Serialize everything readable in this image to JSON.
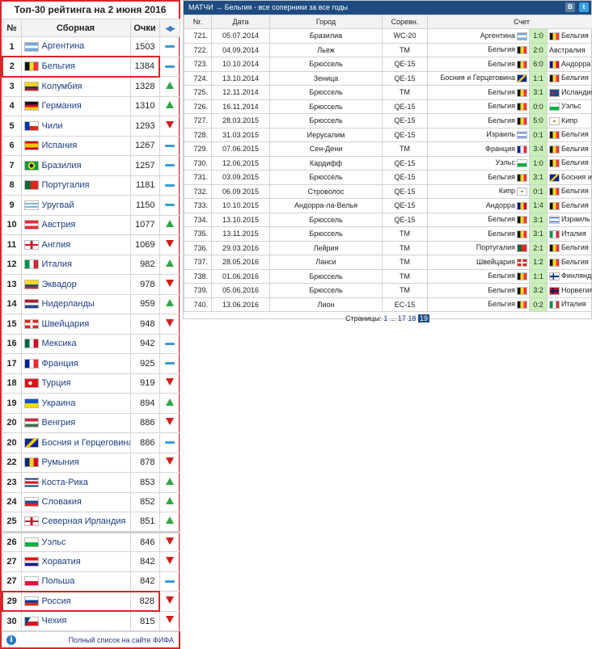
{
  "colors": {
    "highlight": "#d7262b",
    "header_bg": "#1e4c82",
    "score_bg": "#c8f0b8",
    "up": "#2ea843",
    "down": "#d21d1d",
    "same": "#3a9bd4"
  },
  "flags": {
    "ARG": "linear-gradient(#75aadb 33%,#fff 33%,#fff 66%,#75aadb 66%)",
    "BEL": "linear-gradient(90deg,#111 33%,#fdda24 33%,#fdda24 66%,#ef3340 66%)",
    "COL": "linear-gradient(#fcd116 50%,#003893 50%,#003893 75%,#ce1126 75%)",
    "GER": "linear-gradient(#111 33%,#dd0000 33%,#dd0000 66%,#ffce00 66%)",
    "CHI": "linear-gradient(90deg,#0039a6 35%,transparent 35%),linear-gradient(#fff 50%,#d52b1e 50%)",
    "ESP": "linear-gradient(#c60b1e 25%,#ffc400 25%,#ffc400 75%,#c60b1e 75%)",
    "BRA": "radial-gradient(circle,#002776 25%,#ffdf00 26%,#ffdf00 45%,#009c3b 46%)",
    "POR": "linear-gradient(90deg,#046a38 40%,#da291c 40%)",
    "URU": "linear-gradient(#fff 20%,#7bb8e8 20%,#7bb8e8 40%,#fff 40%,#fff 60%,#7bb8e8 60%,#7bb8e8 80%,#fff 80%)",
    "AUT": "linear-gradient(#ed2939 33%,#fff 33%,#fff 66%,#ed2939 66%)",
    "ENG": "linear-gradient(90deg,transparent 42%,#cf142b 42%,#cf142b 58%,transparent 58%),linear-gradient(#fff 40%,#cf142b 40%,#cf142b 60%,#fff 60%)",
    "ITA": "linear-gradient(90deg,#009246 33%,#fff 33%,#fff 66%,#ce2b37 66%)",
    "ECU": "linear-gradient(#ffdd00 50%,#034ea2 50%,#034ea2 75%,#ed1c24 75%)",
    "NED": "linear-gradient(#ae1c28 33%,#fff 33%,#fff 66%,#21468b 66%)",
    "SUI": "linear-gradient(90deg,transparent 42%,#fff 42%,#fff 58%,transparent 58%),linear-gradient(#d52b1e 35%,#fff 35%,#fff 65%,#d52b1e 65%)",
    "MEX": "linear-gradient(90deg,#006847 33%,#fff 33%,#fff 66%,#ce1126 66%)",
    "FRA": "linear-gradient(90deg,#002395 33%,#fff 33%,#fff 66%,#ed2939 66%)",
    "TUR": "radial-gradient(circle at 40% 50%,#fff 20%,#e30a17 22%)",
    "UKR": "linear-gradient(#0057b7 50%,#ffd700 50%)",
    "HUN": "linear-gradient(#cd2a3e 33%,#fff 33%,#fff 66%,#436f4d 66%)",
    "BIH": "linear-gradient(135deg,#002395 40%,#fecb00 40%,#fecb00 60%,#002395 60%)",
    "ROU": "linear-gradient(90deg,#002b7f 33%,#fcd116 33%,#fcd116 66%,#ce1126 66%)",
    "CRC": "linear-gradient(#002b7f 17%,#fff 17%,#fff 33%,#ce1126 33%,#ce1126 67%,#fff 67%,#fff 83%,#002b7f 83%)",
    "SVK": "linear-gradient(#fff 33%,#0b4ea2 33%,#0b4ea2 66%,#ee1c25 66%)",
    "NIR": "linear-gradient(90deg,transparent 42%,#cf142b 42%,#cf142b 58%,transparent 58%),linear-gradient(#fff 40%,#cf142b 40%,#cf142b 60%,#fff 60%)",
    "WAL": "linear-gradient(#fff 50%,#00b140 50%)",
    "CRO": "linear-gradient(#ff0000 33%,#fff 33%,#fff 66%,#171796 66%)",
    "POL": "linear-gradient(#fff 50%,#dc143c 50%)",
    "RUS": "linear-gradient(#fff 33%,#0039a6 33%,#0039a6 66%,#d52b1e 66%)",
    "CZE": "linear-gradient(120deg,#11457e 30%,transparent 30%),linear-gradient(#fff 50%,#d7141a 50%)",
    "AND": "linear-gradient(90deg,#10069f 33%,#fedd00 33%,#fedd00 66%,#d50032 66%)",
    "ISL": "linear-gradient(90deg,transparent 30%,#dc1e35 30%,#dc1e35 42%,transparent 42%),linear-gradient(#02529c 42%,#dc1e35 42%,#dc1e35 58%,#02529c 58%)",
    "CYP": "radial-gradient(ellipse at 50% 50%,#d57800 18%,#fff 22%)",
    "ISR": "linear-gradient(#fff 15%,#0038b8 15%,#0038b8 25%,#fff 25%,#fff 75%,#0038b8 75%,#0038b8 85%,#fff 85%)",
    "FIN": "linear-gradient(90deg,transparent 30%,#003580 30%,#003580 45%,transparent 45%),linear-gradient(#fff 40%,#003580 40%,#003580 60%,#fff 60%)",
    "NOR": "linear-gradient(90deg,transparent 28%,#00205b 28%,#00205b 40%,transparent 40%),linear-gradient(#ba0c2f 40%,#00205b 40%,#00205b 60%,#ba0c2f 60%)"
  },
  "ranking": {
    "title": "Топ-30 рейтинга на 2 июня 2016",
    "col_num": "№",
    "col_team": "Сборная",
    "col_points": "Очки",
    "rows": [
      {
        "rank": "1",
        "team": "Аргентина",
        "points": "1503",
        "change": "same",
        "flag": "ARG"
      },
      {
        "rank": "2",
        "team": "Бельгия",
        "points": "1384",
        "change": "same",
        "flag": "BEL",
        "highlight": true
      },
      {
        "rank": "3",
        "team": "Колумбия",
        "points": "1328",
        "change": "up",
        "flag": "COL"
      },
      {
        "rank": "4",
        "team": "Германия",
        "points": "1310",
        "change": "up",
        "flag": "GER"
      },
      {
        "rank": "5",
        "team": "Чили",
        "points": "1293",
        "change": "down",
        "flag": "CHI"
      },
      {
        "rank": "6",
        "team": "Испания",
        "points": "1267",
        "change": "same",
        "flag": "ESP"
      },
      {
        "rank": "7",
        "team": "Бразилия",
        "points": "1257",
        "change": "same",
        "flag": "BRA"
      },
      {
        "rank": "8",
        "team": "Португалия",
        "points": "1181",
        "change": "same",
        "flag": "POR"
      },
      {
        "rank": "9",
        "team": "Уругвай",
        "points": "1150",
        "change": "same",
        "flag": "URU"
      },
      {
        "rank": "10",
        "team": "Австрия",
        "points": "1077",
        "change": "up",
        "flag": "AUT"
      },
      {
        "rank": "11",
        "team": "Англия",
        "points": "1069",
        "change": "down",
        "flag": "ENG"
      },
      {
        "rank": "12",
        "team": "Италия",
        "points": "982",
        "change": "up",
        "flag": "ITA"
      },
      {
        "rank": "13",
        "team": "Эквадор",
        "points": "978",
        "change": "down",
        "flag": "ECU"
      },
      {
        "rank": "14",
        "team": "Нидерланды",
        "points": "959",
        "change": "up",
        "flag": "NED"
      },
      {
        "rank": "15",
        "team": "Швейцария",
        "points": "948",
        "change": "down",
        "flag": "SUI"
      },
      {
        "rank": "16",
        "team": "Мексика",
        "points": "942",
        "change": "same",
        "flag": "MEX"
      },
      {
        "rank": "17",
        "team": "Франция",
        "points": "925",
        "change": "same",
        "flag": "FRA"
      },
      {
        "rank": "18",
        "team": "Турция",
        "points": "919",
        "change": "down",
        "flag": "TUR"
      },
      {
        "rank": "19",
        "team": "Украина",
        "points": "894",
        "change": "up",
        "flag": "UKR"
      },
      {
        "rank": "20",
        "team": "Венгрия",
        "points": "886",
        "change": "down",
        "flag": "HUN"
      },
      {
        "rank": "20",
        "team": "Босния и Герцеговина",
        "points": "886",
        "change": "same",
        "flag": "BIH"
      },
      {
        "rank": "22",
        "team": "Румыния",
        "points": "878",
        "change": "down",
        "flag": "ROU"
      },
      {
        "rank": "23",
        "team": "Коста-Рика",
        "points": "853",
        "change": "up",
        "flag": "CRC"
      },
      {
        "rank": "24",
        "team": "Словакия",
        "points": "852",
        "change": "up",
        "flag": "SVK"
      },
      {
        "rank": "25",
        "team": "Северная Ирландия",
        "points": "851",
        "change": "up",
        "flag": "NIR"
      },
      {
        "rank": "26",
        "team": "Уэльс",
        "points": "846",
        "change": "down",
        "flag": "WAL",
        "gap": true
      },
      {
        "rank": "27",
        "team": "Хорватия",
        "points": "842",
        "change": "down",
        "flag": "CRO"
      },
      {
        "rank": "27",
        "team": "Польша",
        "points": "842",
        "change": "same",
        "flag": "POL"
      },
      {
        "rank": "29",
        "team": "Россия",
        "points": "828",
        "change": "down",
        "flag": "RUS",
        "highlight": true
      },
      {
        "rank": "30",
        "team": "Чехия",
        "points": "815",
        "change": "down",
        "flag": "CZE"
      }
    ],
    "footer_link": "Полный список на сайте ФИФА"
  },
  "matches": {
    "header": "МАТЧИ → Бельгия - все соперники за все годы",
    "social": [
      "В",
      "t"
    ],
    "columns": {
      "num": "Nr.",
      "date": "Дата",
      "city": "Город",
      "comp": "Соревн.",
      "score": "Счет"
    },
    "rows": [
      {
        "num": "721.",
        "date": "05.07.2014",
        "city": "Бразилиа",
        "comp": "WC-20",
        "home": "Аргентина",
        "home_flag": "ARG",
        "score": "1:0",
        "away": "Бельгия",
        "away_flag": "BEL"
      },
      {
        "num": "722.",
        "date": "04.09.2014",
        "city": "Льеж",
        "comp": "TM",
        "home": "Бельгия",
        "home_flag": "BEL",
        "score": "2:0",
        "away": "Австралия",
        "away_flag": ""
      },
      {
        "num": "723.",
        "date": "10.10.2014",
        "city": "Брюссель",
        "comp": "QE-15",
        "home": "Бельгия",
        "home_flag": "BEL",
        "score": "6:0",
        "away": "Андорра",
        "away_flag": "AND"
      },
      {
        "num": "724.",
        "date": "13.10.2014",
        "city": "Зеница",
        "comp": "QE-15",
        "home": "Босния и Герцеговина",
        "home_flag": "BIH",
        "score": "1:1",
        "away": "Бельгия",
        "away_flag": "BEL"
      },
      {
        "num": "725.",
        "date": "12.11.2014",
        "city": "Брюссель",
        "comp": "TM",
        "home": "Бельгия",
        "home_flag": "BEL",
        "score": "3:1",
        "away": "Исландия",
        "away_flag": "ISL"
      },
      {
        "num": "726.",
        "date": "16.11.2014",
        "city": "Брюссель",
        "comp": "QE-15",
        "home": "Бельгия",
        "home_flag": "BEL",
        "score": "0:0",
        "away": "Уэльс",
        "away_flag": "WAL"
      },
      {
        "num": "727.",
        "date": "28.03.2015",
        "city": "Брюссель",
        "comp": "QE-15",
        "home": "Бельгия",
        "home_flag": "BEL",
        "score": "5:0",
        "away": "Кипр",
        "away_flag": "CYP"
      },
      {
        "num": "728.",
        "date": "31.03.2015",
        "city": "Иерусалим",
        "comp": "QE-15",
        "home": "Израиль",
        "home_flag": "ISR",
        "score": "0:1",
        "away": "Бельгия",
        "away_flag": "BEL"
      },
      {
        "num": "729.",
        "date": "07.06.2015",
        "city": "Сен-Дени",
        "comp": "TM",
        "home": "Франция",
        "home_flag": "FRA",
        "score": "3:4",
        "away": "Бельгия",
        "away_flag": "BEL"
      },
      {
        "num": "730.",
        "date": "12.06.2015",
        "city": "Кардифф",
        "comp": "QE-15",
        "home": "Уэльс",
        "home_flag": "WAL",
        "score": "1:0",
        "away": "Бельгия",
        "away_flag": "BEL"
      },
      {
        "num": "731.",
        "date": "03.09.2015",
        "city": "Брюссель",
        "comp": "QE-15",
        "home": "Бельгия",
        "home_flag": "BEL",
        "score": "3:1",
        "away": "Босния и Герцеговина",
        "away_flag": "BIH"
      },
      {
        "num": "732.",
        "date": "06.09.2015",
        "city": "Строволос",
        "comp": "QE-15",
        "home": "Кипр",
        "home_flag": "CYP",
        "score": "0:1",
        "away": "Бельгия",
        "away_flag": "BEL"
      },
      {
        "num": "733.",
        "date": "10.10.2015",
        "city": "Андорра-ла-Велья",
        "comp": "QE-15",
        "home": "Андорра",
        "home_flag": "AND",
        "score": "1:4",
        "away": "Бельгия",
        "away_flag": "BEL"
      },
      {
        "num": "734.",
        "date": "13.10.2015",
        "city": "Брюссель",
        "comp": "QE-15",
        "home": "Бельгия",
        "home_flag": "BEL",
        "score": "3:1",
        "away": "Израиль",
        "away_flag": "ISR"
      },
      {
        "num": "735.",
        "date": "13.11.2015",
        "city": "Брюссель",
        "comp": "TM",
        "home": "Бельгия",
        "home_flag": "BEL",
        "score": "3:1",
        "away": "Италия",
        "away_flag": "ITA"
      },
      {
        "num": "736.",
        "date": "29.03.2016",
        "city": "Лейрия",
        "comp": "TM",
        "home": "Португалия",
        "home_flag": "POR",
        "score": "2:1",
        "away": "Бельгия",
        "away_flag": "BEL"
      },
      {
        "num": "737.",
        "date": "28.05.2016",
        "city": "Ланси",
        "comp": "TM",
        "home": "Швейцария",
        "home_flag": "SUI",
        "score": "1:2",
        "away": "Бельгия",
        "away_flag": "BEL"
      },
      {
        "num": "738.",
        "date": "01.06.2016",
        "city": "Брюссель",
        "comp": "TM",
        "home": "Бельгия",
        "home_flag": "BEL",
        "score": "1:1",
        "away": "Финляндия",
        "away_flag": "FIN"
      },
      {
        "num": "739.",
        "date": "05.06.2016",
        "city": "Брюссель",
        "comp": "TM",
        "home": "Бельгия",
        "home_flag": "BEL",
        "score": "3:2",
        "away": "Норвегия",
        "away_flag": "NOR"
      },
      {
        "num": "740.",
        "date": "13.06.2016",
        "city": "Лион",
        "comp": "EC-15",
        "home": "Бельгия",
        "home_flag": "BEL",
        "score": "0:2",
        "away": "Италия",
        "away_flag": "ITA"
      }
    ],
    "pager": {
      "label": "Страницы:",
      "first": "1",
      "ellipsis": "...",
      "p17": "17",
      "p18": "18",
      "current": "19"
    }
  }
}
